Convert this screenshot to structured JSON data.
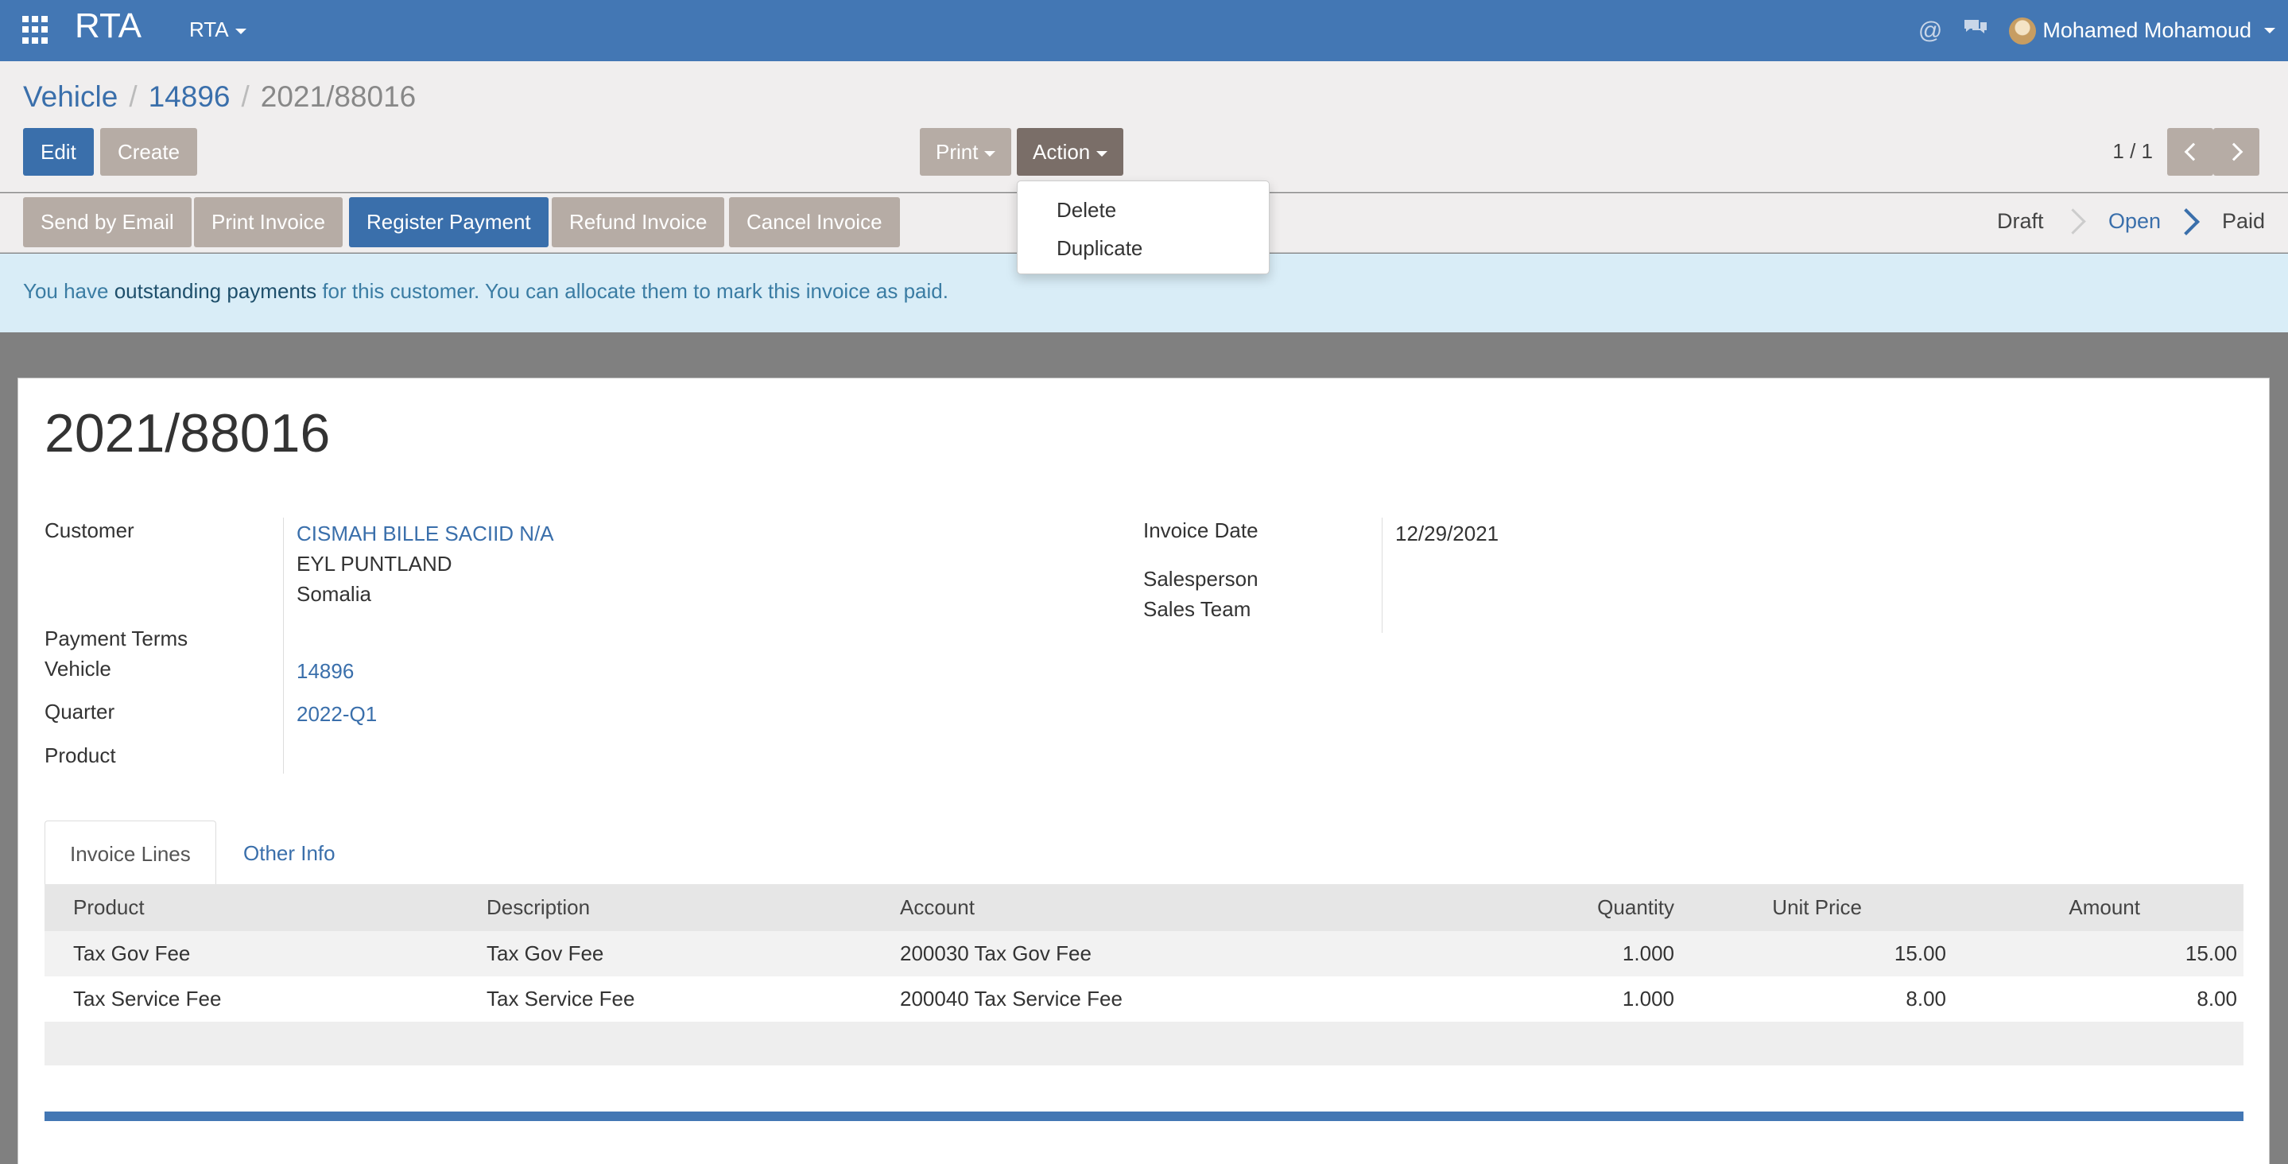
{
  "navbar": {
    "brand": "RTA",
    "menu": "RTA",
    "user_name": "Mohamed Mohamoud",
    "icons": [
      "apps-icon",
      "at-icon",
      "chat-icon",
      "avatar",
      "caret-down-icon"
    ]
  },
  "breadcrumb": {
    "root": "Vehicle",
    "middle": "14896",
    "current": "2021/88016"
  },
  "buttons": {
    "edit": "Edit",
    "create": "Create",
    "print": "Print",
    "action": "Action"
  },
  "pager": {
    "value": "1 / 1"
  },
  "action_menu": {
    "items": [
      "Delete",
      "Duplicate"
    ]
  },
  "statusbar": {
    "buttons": [
      "Send by Email",
      "Print Invoice",
      "Register Payment",
      "Refund Invoice",
      "Cancel Invoice"
    ],
    "stages": [
      "Draft",
      "Open",
      "Paid"
    ],
    "current_stage": "Open"
  },
  "alert": {
    "prefix": "You have ",
    "link": "outstanding payments",
    "suffix": " for this customer. You can allocate them to mark this invoice as paid."
  },
  "invoice": {
    "title": "2021/88016",
    "labels": {
      "customer": "Customer",
      "payment_terms": "Payment Terms",
      "vehicle": "Vehicle",
      "quarter": "Quarter",
      "product": "Product",
      "invoice_date": "Invoice Date",
      "salesperson": "Salesperson",
      "sales_team": "Sales Team"
    },
    "customer_name": "CISMAH BILLE SACIID N/A",
    "customer_line2": "EYL PUNTLAND",
    "customer_line3": "Somalia",
    "vehicle": "14896",
    "quarter": "2022-Q1",
    "invoice_date": "12/29/2021"
  },
  "tabs": [
    "Invoice Lines",
    "Other Info"
  ],
  "lines": {
    "columns": [
      "Product",
      "Description",
      "Account",
      "Quantity",
      "Unit Price",
      "Amount"
    ],
    "rows": [
      [
        "Tax Gov Fee",
        "Tax Gov Fee",
        "200030 Tax Gov Fee",
        "1.000",
        "15.00",
        "15.00"
      ],
      [
        "Tax Service Fee",
        "Tax Service Fee",
        "200040 Tax Service Fee",
        "1.000",
        "8.00",
        "8.00"
      ]
    ]
  },
  "colors": {
    "primary": "#3a6fab",
    "navbar": "#4377b4",
    "secondary": "#b6aca5",
    "alert_bg": "#d9edf7"
  }
}
